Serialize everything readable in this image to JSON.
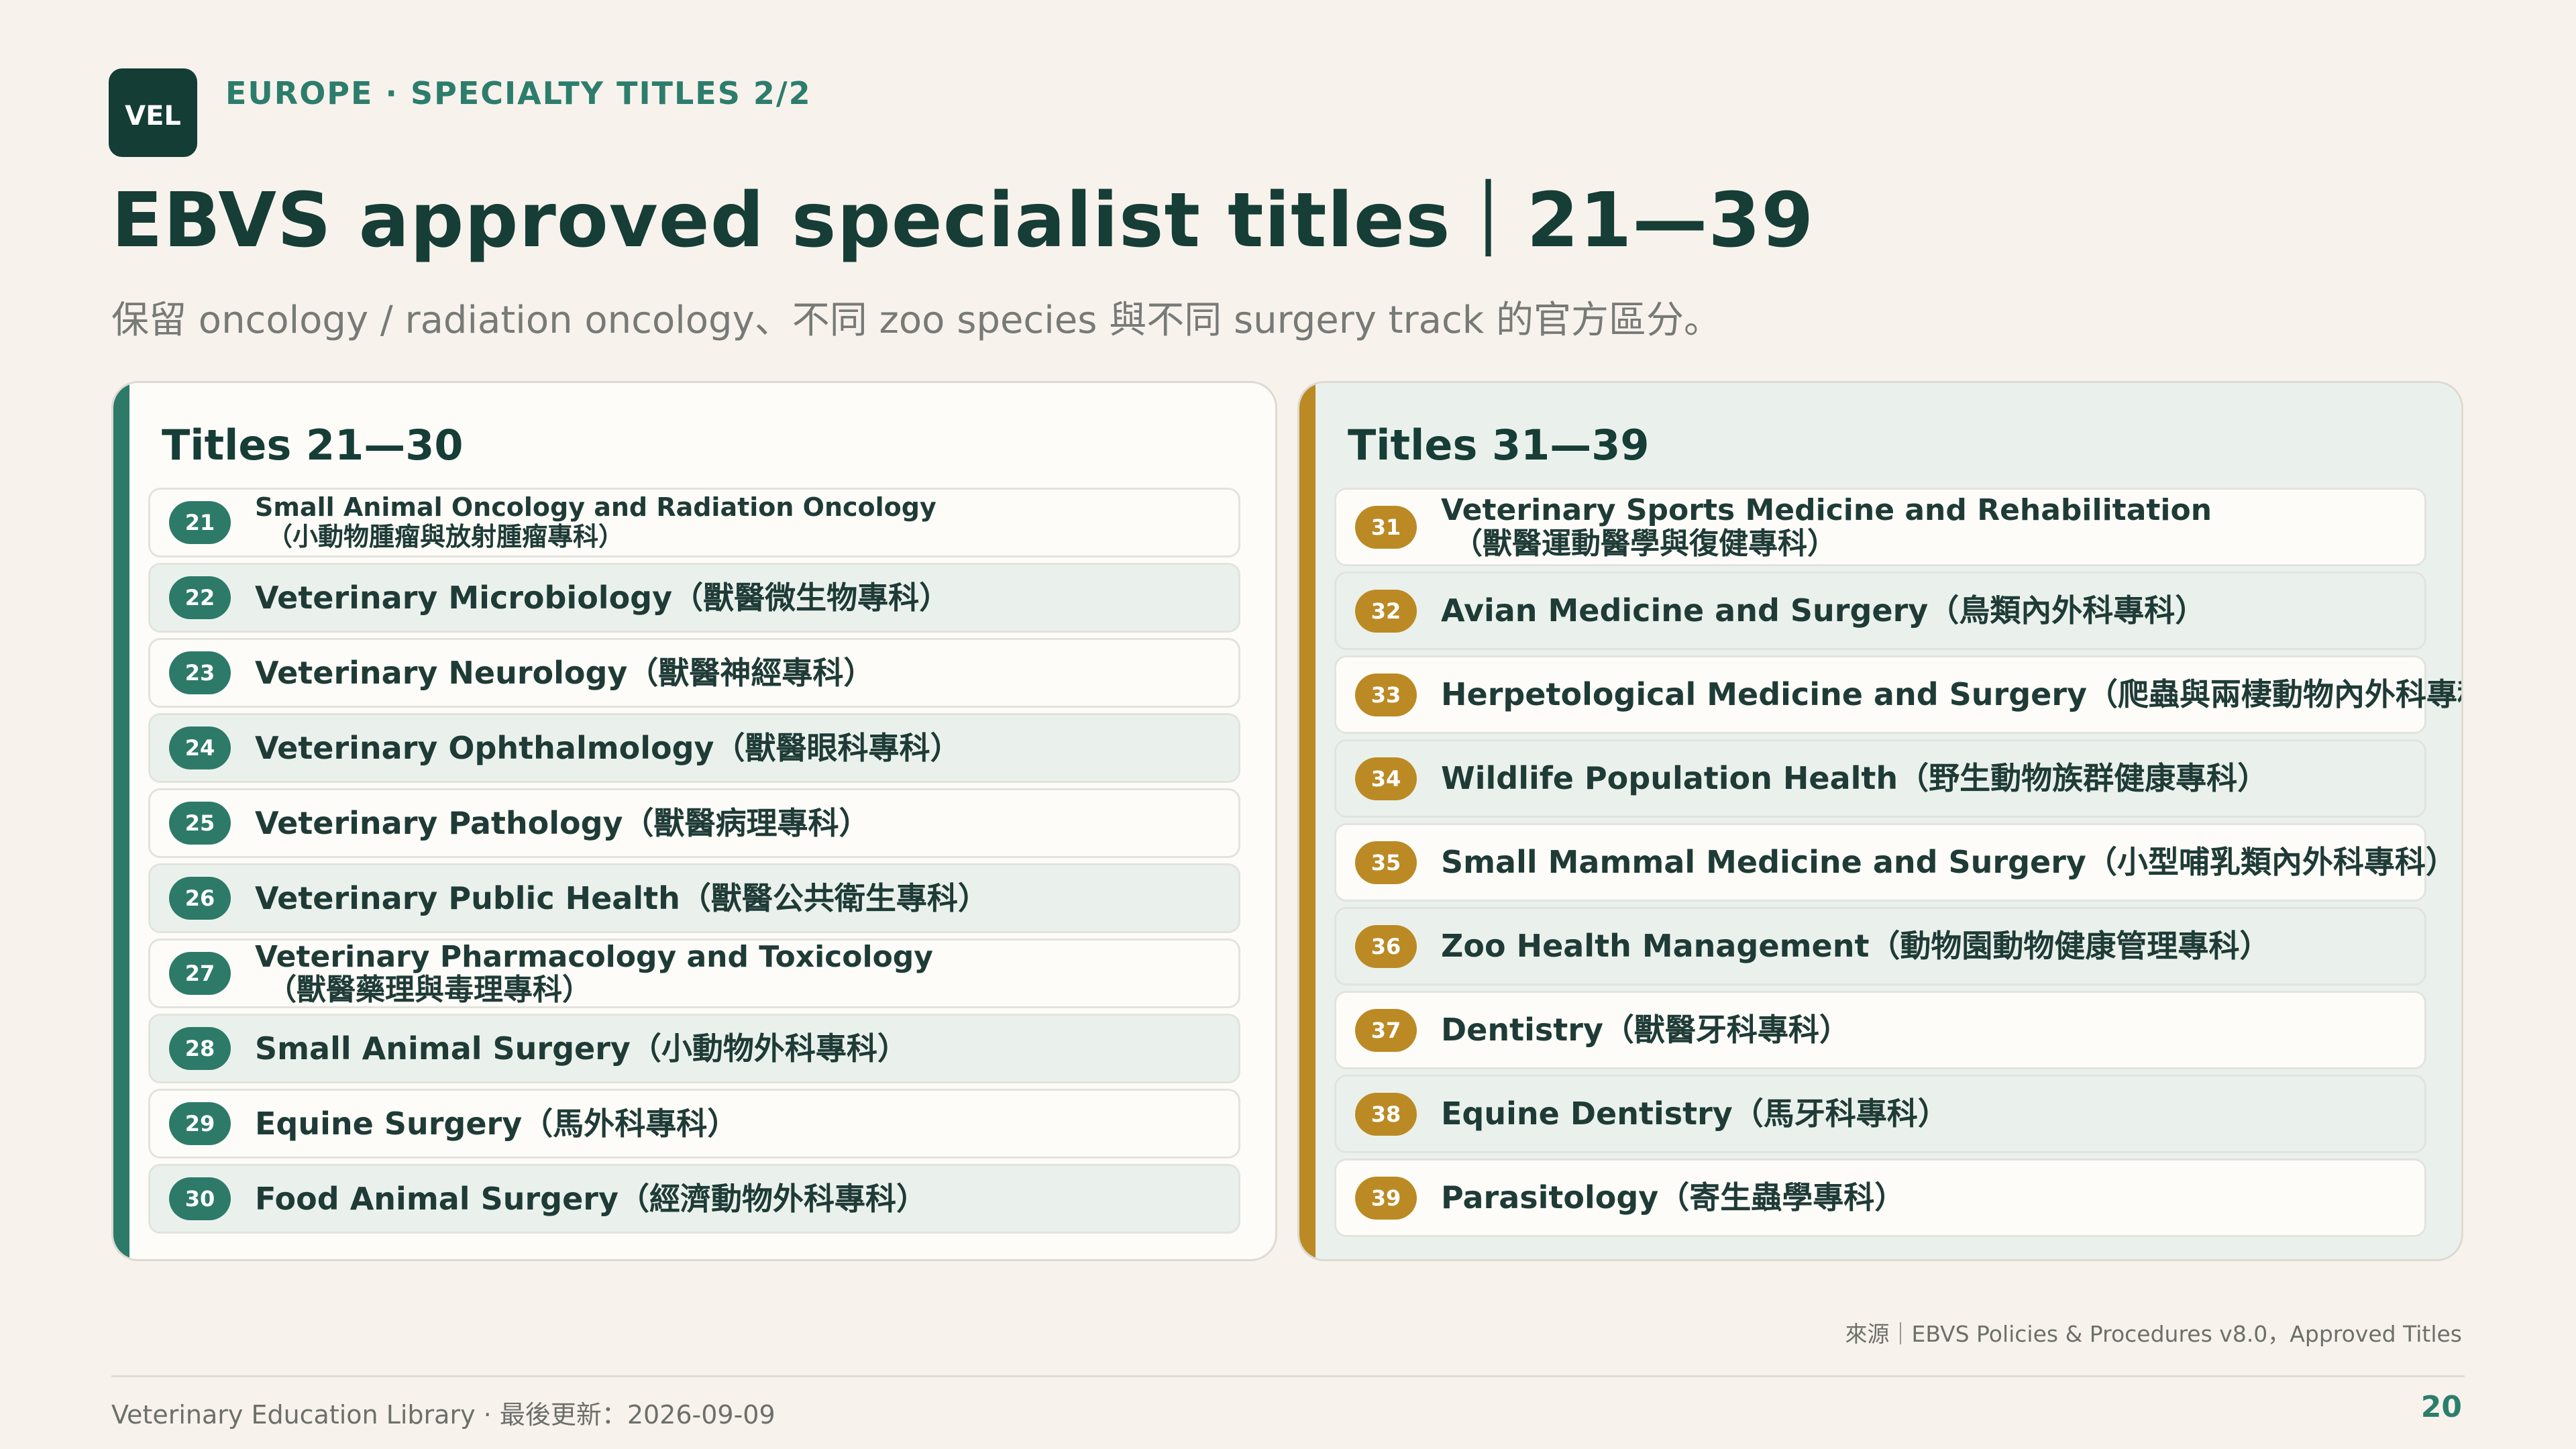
{
  "logo": {
    "text": "VEL"
  },
  "header": {
    "eyebrow": "EUROPE · SPECIALTY TITLES 2/2",
    "title": "EBVS approved specialist titles｜21—39",
    "subtitle": "保留 oncology / radiation oncology、不同 zoo species 與不同 surgery track 的官方區分。"
  },
  "left_panel": {
    "title": "Titles 21—30",
    "accent": "#2d7a69",
    "items": [
      {
        "num": "21",
        "line1": "Small Animal Oncology and Radiation Oncology",
        "line2": "（小動物腫瘤與放射腫瘤專科）"
      },
      {
        "num": "22",
        "line1": "Veterinary Microbiology（獸醫微生物專科）"
      },
      {
        "num": "23",
        "line1": "Veterinary Neurology（獸醫神經專科）"
      },
      {
        "num": "24",
        "line1": "Veterinary Ophthalmology（獸醫眼科專科）"
      },
      {
        "num": "25",
        "line1": "Veterinary Pathology（獸醫病理專科）"
      },
      {
        "num": "26",
        "line1": "Veterinary Public Health（獸醫公共衛生專科）"
      },
      {
        "num": "27",
        "line1": "Veterinary Pharmacology and Toxicology",
        "line2": "（獸醫藥理與毒理專科）"
      },
      {
        "num": "28",
        "line1": "Small Animal Surgery（小動物外科專科）"
      },
      {
        "num": "29",
        "line1": "Equine Surgery（馬外科專科）"
      },
      {
        "num": "30",
        "line1": "Food Animal Surgery（經濟動物外科專科）"
      }
    ]
  },
  "right_panel": {
    "title": "Titles 31—39",
    "accent": "#bb8a24",
    "items": [
      {
        "num": "31",
        "line1": "Veterinary Sports Medicine and Rehabilitation",
        "line2": "（獸醫運動醫學與復健專科）"
      },
      {
        "num": "32",
        "line1": "Avian Medicine and Surgery（鳥類內外科專科）"
      },
      {
        "num": "33",
        "line1": "Herpetological Medicine and Surgery（爬蟲與兩棲動物內外科專科）"
      },
      {
        "num": "34",
        "line1": "Wildlife Population Health（野生動物族群健康專科）"
      },
      {
        "num": "35",
        "line1": "Small Mammal Medicine and Surgery（小型哺乳類內外科專科）"
      },
      {
        "num": "36",
        "line1": "Zoo Health Management（動物園動物健康管理專科）"
      },
      {
        "num": "37",
        "line1": "Dentistry（獸醫牙科專科）"
      },
      {
        "num": "38",
        "line1": "Equine Dentistry（馬牙科專科）"
      },
      {
        "num": "39",
        "line1": "Parasitology（寄生蟲學專科）"
      }
    ]
  },
  "footer": {
    "source": "來源｜EBVS Policies & Procedures v8.0，Approved Titles",
    "left": "Veterinary Education Library · 最後更新：2026-09-09",
    "page": "20"
  }
}
